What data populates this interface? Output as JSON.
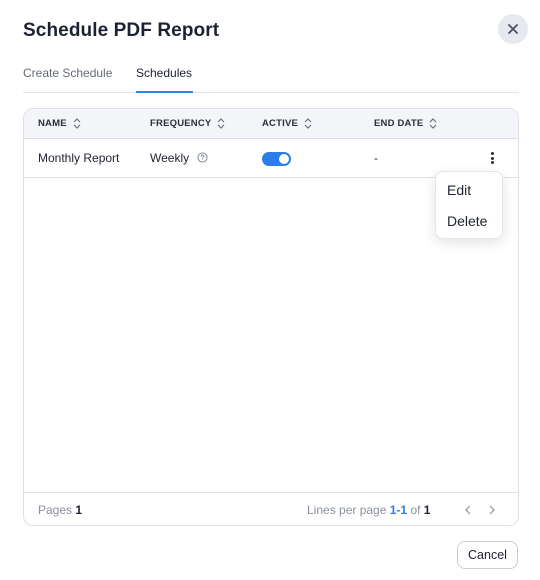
{
  "dialog": {
    "title": "Schedule PDF Report"
  },
  "tabs": [
    {
      "label": "Create Schedule",
      "active": false
    },
    {
      "label": "Schedules",
      "active": true
    }
  ],
  "table": {
    "columns": [
      "NAME",
      "FREQUENCY",
      "ACTIVE",
      "END DATE"
    ],
    "rows": [
      {
        "name": "Monthly Report",
        "frequency": "Weekly",
        "active": true,
        "end_date": "-"
      }
    ]
  },
  "row_menu": {
    "items": [
      "Edit",
      "Delete"
    ]
  },
  "footer": {
    "pages_label": "Pages",
    "pages_value": "1",
    "lines_label": "Lines per page",
    "lines_range": "1-1",
    "of_label": "of",
    "total": "1"
  },
  "actions": {
    "cancel_label": "Cancel"
  },
  "colors": {
    "accent": "#2b7de9",
    "title": "#1d2233",
    "border": "#dde1e8"
  },
  "icons": {
    "close": "close-icon",
    "sort": "sort-icon",
    "help": "help-icon",
    "more": "kebab-menu-icon",
    "prev": "chevron-left-icon",
    "next": "chevron-right-icon"
  }
}
